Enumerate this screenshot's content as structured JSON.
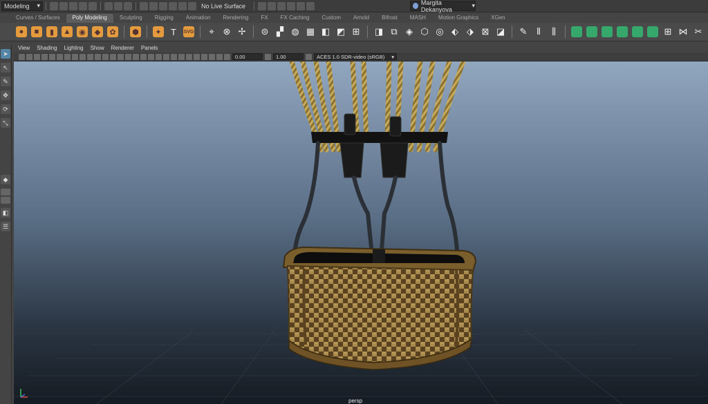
{
  "statusline": {
    "mode": "Modeling",
    "live_surface": "No Live Surface",
    "user": "Margita Dekanyova"
  },
  "shelf_tabs": [
    {
      "label": "Curves / Surfaces",
      "active": false
    },
    {
      "label": "Poly Modeling",
      "active": true
    },
    {
      "label": "Sculpting",
      "active": false
    },
    {
      "label": "Rigging",
      "active": false
    },
    {
      "label": "Animation",
      "active": false
    },
    {
      "label": "Rendering",
      "active": false
    },
    {
      "label": "FX",
      "active": false
    },
    {
      "label": "FX Caching",
      "active": false
    },
    {
      "label": "Custom",
      "active": false
    },
    {
      "label": "Arnold",
      "active": false
    },
    {
      "label": "Bifrost",
      "active": false
    },
    {
      "label": "MASH",
      "active": false
    },
    {
      "label": "Motion Graphics",
      "active": false
    },
    {
      "label": "XGen",
      "active": false
    }
  ],
  "shelf": {
    "svg_label": "SVG",
    "type_label": "T"
  },
  "panel_menu": [
    "View",
    "Shading",
    "Lighting",
    "Show",
    "Renderer",
    "Panels"
  ],
  "panel_toolbar": {
    "exposure": "0.00",
    "gamma": "1.00",
    "color_space": "ACES 1.0 SDR-video (sRGB)"
  },
  "viewport": {
    "camera": "persp"
  },
  "colors": {
    "shelf_orange": "#e49b3d",
    "shelf_green": "#37a86b",
    "tool_active": "#5285a6",
    "basket_weave_light": "#a88a4c",
    "basket_weave_dark": "#5a4220",
    "rope": "#b19548"
  }
}
